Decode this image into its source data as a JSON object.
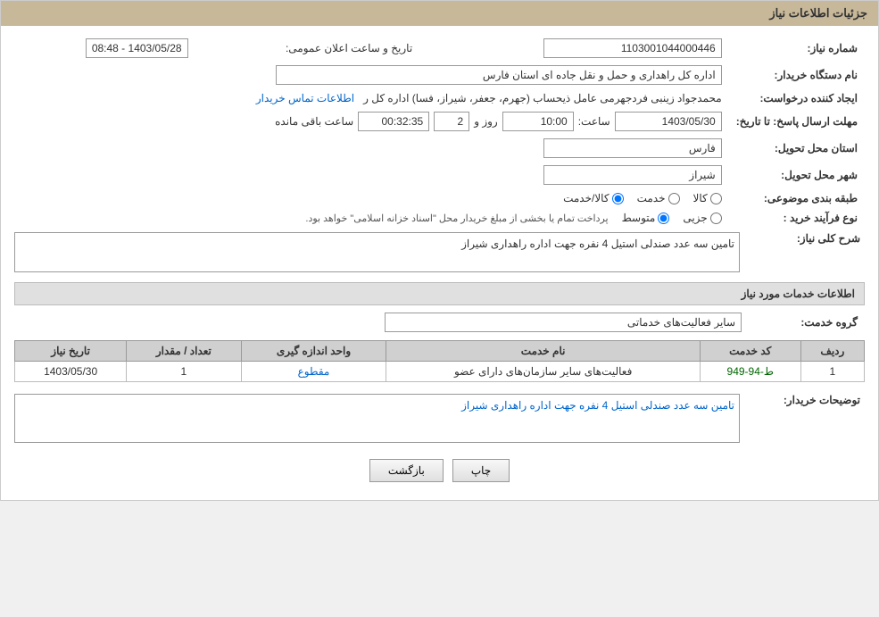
{
  "page": {
    "title": "جزئیات اطلاعات نیاز"
  },
  "header": {
    "announcement_label": "تاریخ و ساعت اعلان عمومی:",
    "announcement_value": "1403/05/28 - 08:48",
    "need_number_label": "شماره نیاز:",
    "need_number_value": "1103001044000446"
  },
  "fields": {
    "buyer_org_label": "نام دستگاه خریدار:",
    "buyer_org_value": "اداره کل راهداری و حمل و نقل جاده ای استان فارس",
    "creator_label": "ایجاد کننده درخواست:",
    "creator_value": "محمدجواد زینبی فردجهرمی عامل ذیحساب (جهرم، جعفر، شیراز، فسا) اداره کل ر",
    "creator_link": "اطلاعات تماس خریدار",
    "deadline_label": "مهلت ارسال پاسخ: تا تاریخ:",
    "deadline_date": "1403/05/30",
    "deadline_time_label": "ساعت:",
    "deadline_time": "10:00",
    "deadline_day_label": "روز و",
    "deadline_days": "2",
    "remaining_label": "ساعت باقی مانده",
    "remaining_time": "00:32:35",
    "province_label": "استان محل تحویل:",
    "province_value": "فارس",
    "city_label": "شهر محل تحویل:",
    "city_value": "شیراز",
    "category_label": "طبقه بندی موضوعی:",
    "category_options": [
      {
        "label": "کالا",
        "value": "kala",
        "selected": false
      },
      {
        "label": "خدمت",
        "value": "khedmat",
        "selected": false
      },
      {
        "label": "کالا/خدمت",
        "value": "kala_khedmat",
        "selected": true
      }
    ],
    "purchase_type_label": "نوع فرآیند خرید :",
    "purchase_type_options": [
      {
        "label": "جزیی",
        "value": "jozi",
        "selected": false
      },
      {
        "label": "متوسط",
        "value": "motavasset",
        "selected": true
      }
    ],
    "purchase_type_note": "پرداخت تمام یا بخشی از مبلغ خریدار محل \"اسناد خزانه اسلامی\" خواهد بود.",
    "need_summary_label": "شرح کلی نیاز:",
    "need_summary_value": "تامین سه عدد صندلی استیل 4 نفره جهت اداره راهداری شیراز"
  },
  "services_section": {
    "title": "اطلاعات خدمات مورد نیاز",
    "service_group_label": "گروه خدمت:",
    "service_group_value": "سایر فعالیت‌های خدماتی",
    "table": {
      "headers": [
        "ردیف",
        "کد خدمت",
        "نام خدمت",
        "واحد اندازه گیری",
        "تعداد / مقدار",
        "تاریخ نیاز"
      ],
      "rows": [
        {
          "row": "1",
          "code": "ط-94-949",
          "name": "فعالیت‌های سایر سازمان‌های دارای عضو",
          "unit": "مقطوع",
          "quantity": "1",
          "date": "1403/05/30"
        }
      ]
    }
  },
  "buyer_notes": {
    "label": "توضیحات خریدار:",
    "value": "تامین سه عدد صندلی استیل 4 نفره جهت اداره راهداری شیراز"
  },
  "buttons": {
    "back": "بازگشت",
    "print": "چاپ"
  }
}
